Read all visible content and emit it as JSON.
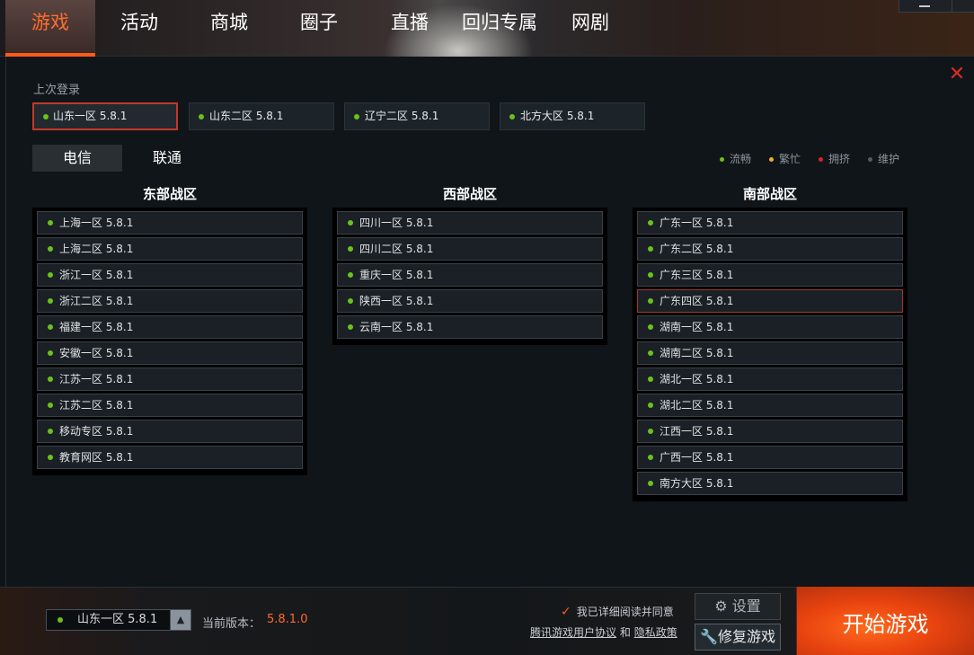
{
  "nav": {
    "tabs": [
      {
        "label": "游戏",
        "active": true
      },
      {
        "label": "活动"
      },
      {
        "label": "商城"
      },
      {
        "label": "圈子"
      },
      {
        "label": "直播"
      },
      {
        "label": "回归专属"
      },
      {
        "label": "网剧"
      }
    ]
  },
  "last_login": {
    "label": "上次登录",
    "servers": [
      {
        "name": "山东一区 5.8.1",
        "selected": true
      },
      {
        "name": "山东二区 5.8.1"
      },
      {
        "name": "辽宁二区 5.8.1"
      },
      {
        "name": "北方大区 5.8.1"
      }
    ]
  },
  "isp_tabs": [
    {
      "label": "电信",
      "active": true
    },
    {
      "label": "联通"
    }
  ],
  "legend": [
    {
      "label": "流畅",
      "color": "#6ac11c"
    },
    {
      "label": "繁忙",
      "color": "#f0b020"
    },
    {
      "label": "拥挤",
      "color": "#e02020"
    },
    {
      "label": "维护",
      "color": "#555b60"
    }
  ],
  "regions": [
    {
      "title": "东部战区",
      "servers": [
        "上海一区 5.8.1",
        "上海二区 5.8.1",
        "浙江一区 5.8.1",
        "浙江二区 5.8.1",
        "福建一区 5.8.1",
        "安徽一区 5.8.1",
        "江苏一区 5.8.1",
        "江苏二区 5.8.1",
        "移动专区 5.8.1",
        "教育网区 5.8.1"
      ]
    },
    {
      "title": "西部战区",
      "servers": [
        "四川一区 5.8.1",
        "四川二区 5.8.1",
        "重庆一区 5.8.1",
        "陕西一区 5.8.1",
        "云南一区 5.8.1"
      ]
    },
    {
      "title": "南部战区",
      "servers": [
        "广东一区 5.8.1",
        "广东二区 5.8.1",
        "广东三区 5.8.1",
        "广东四区 5.8.1",
        "湖南一区 5.8.1",
        "湖南二区 5.8.1",
        "湖北一区 5.8.1",
        "湖北二区 5.8.1",
        "江西一区 5.8.1",
        "广西一区 5.8.1",
        "南方大区 5.8.1"
      ],
      "selected_index": 3
    }
  ],
  "footer": {
    "selected_server": "山东一区 5.8.1",
    "version_label": "当前版本：",
    "version_value": "5.8.1.0",
    "agree_text": "我已详细阅读并同意",
    "link_agreement": "腾讯游戏用户协议",
    "link_and": "和",
    "link_privacy": "隐私政策",
    "settings_label": "设置",
    "repair_label": "修复游戏",
    "start_label": "开始游戏"
  },
  "colors": {
    "accent": "#ff5a1a",
    "status_ok": "#6ac11c",
    "close": "#d62e20"
  }
}
